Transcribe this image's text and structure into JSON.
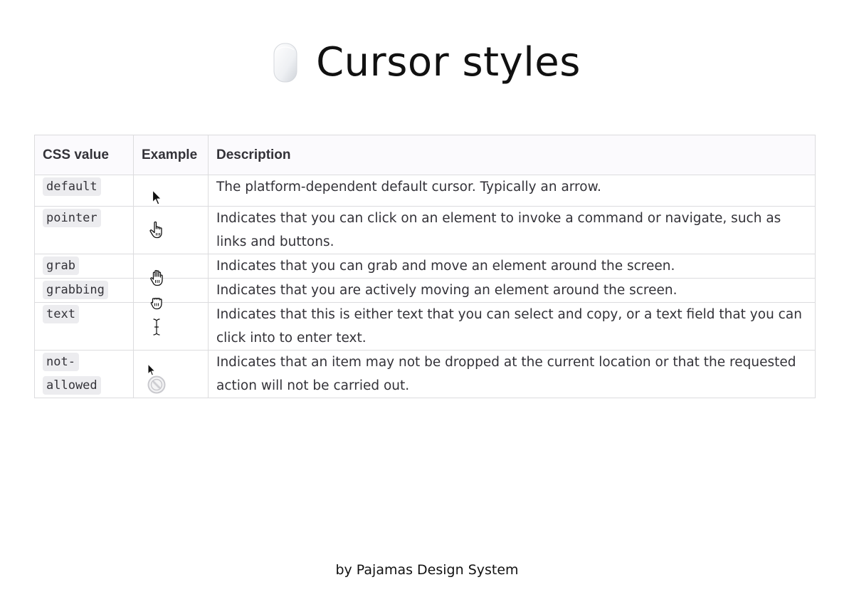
{
  "page": {
    "title": "Cursor styles",
    "title_icon": "mouse-icon",
    "footer": "by Pajamas Design System"
  },
  "table": {
    "headers": [
      "CSS value",
      "Example",
      "Description"
    ],
    "rows": [
      {
        "css_value": "default",
        "example_icon": "arrow-cursor-icon",
        "description": "The platform-dependent default cursor. Typically an arrow."
      },
      {
        "css_value": "pointer",
        "example_icon": "pointer-hand-cursor-icon",
        "description": "Indicates that you can click on an element to invoke a command or navigate, such as links and buttons."
      },
      {
        "css_value": "grab",
        "example_icon": "open-hand-cursor-icon",
        "description": "Indicates that you can grab and move an element around the screen."
      },
      {
        "css_value": "grabbing",
        "example_icon": "closed-hand-cursor-icon",
        "description": "Indicates that you are actively moving an element around the screen."
      },
      {
        "css_value": "text",
        "example_icon": "i-beam-cursor-icon",
        "description": "Indicates that this is either text that you can select and copy, or a text field that you can click into to enter text."
      },
      {
        "css_value": "not-allowed",
        "example_icon": "not-allowed-cursor-icon",
        "description": "Indicates that an item may not be dropped at the current location or that the requested action will not be carried out."
      }
    ]
  },
  "colors": {
    "text": "#333238",
    "border": "#dcdcde",
    "header_bg": "#fbfafd",
    "code_bg": "#ececef"
  }
}
